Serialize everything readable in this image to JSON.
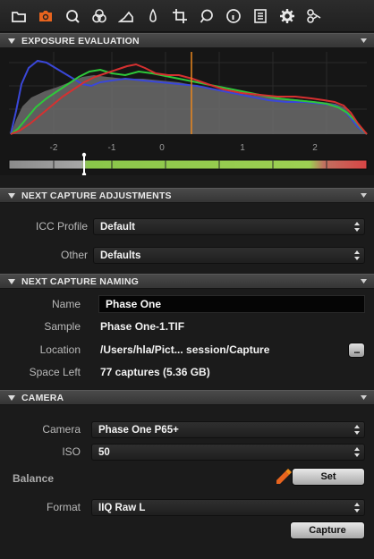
{
  "toolbar": {
    "tools": [
      {
        "icon": "folder-icon",
        "active": false
      },
      {
        "icon": "camera-icon",
        "active": true
      },
      {
        "icon": "loupe-icon",
        "active": false
      },
      {
        "icon": "color-circles-icon",
        "active": false
      },
      {
        "icon": "triangle-exposure-icon",
        "active": false
      },
      {
        "icon": "drop-icon",
        "active": false
      },
      {
        "icon": "crop-icon",
        "active": false
      },
      {
        "icon": "speech-bubble-icon",
        "active": false
      },
      {
        "icon": "info-icon",
        "active": false
      },
      {
        "icon": "list-icon",
        "active": false
      },
      {
        "icon": "gear-icon",
        "active": false
      },
      {
        "icon": "scissors-icon",
        "active": false
      }
    ],
    "active_color": "#e8641e"
  },
  "exposure": {
    "title": "EXPOSURE EVALUATION",
    "ticks": [
      "-2",
      "-1",
      "0",
      "1",
      "2"
    ]
  },
  "adjustments": {
    "title": "NEXT CAPTURE ADJUSTMENTS",
    "icc_label": "ICC Profile",
    "icc_value": "Default",
    "other_label": "Other",
    "other_value": "Defaults"
  },
  "naming": {
    "title": "NEXT CAPTURE NAMING",
    "name_label": "Name",
    "name_value": "Phase One",
    "sample_label": "Sample",
    "sample_value": "Phase One-1.TIF",
    "location_label": "Location",
    "location_value": "/Users/hla/Pict... session/Capture",
    "location_button": "...",
    "space_label": "Space Left",
    "space_value": "77 captures (5.36 GB)"
  },
  "camera": {
    "title": "CAMERA",
    "camera_label": "Camera",
    "camera_value": "Phase One P65+",
    "iso_label": "ISO",
    "iso_value": "50",
    "balance_label": "Balance",
    "set_button": "Set",
    "format_label": "Format",
    "format_value": "IIQ Raw L",
    "capture_button": "Capture"
  }
}
